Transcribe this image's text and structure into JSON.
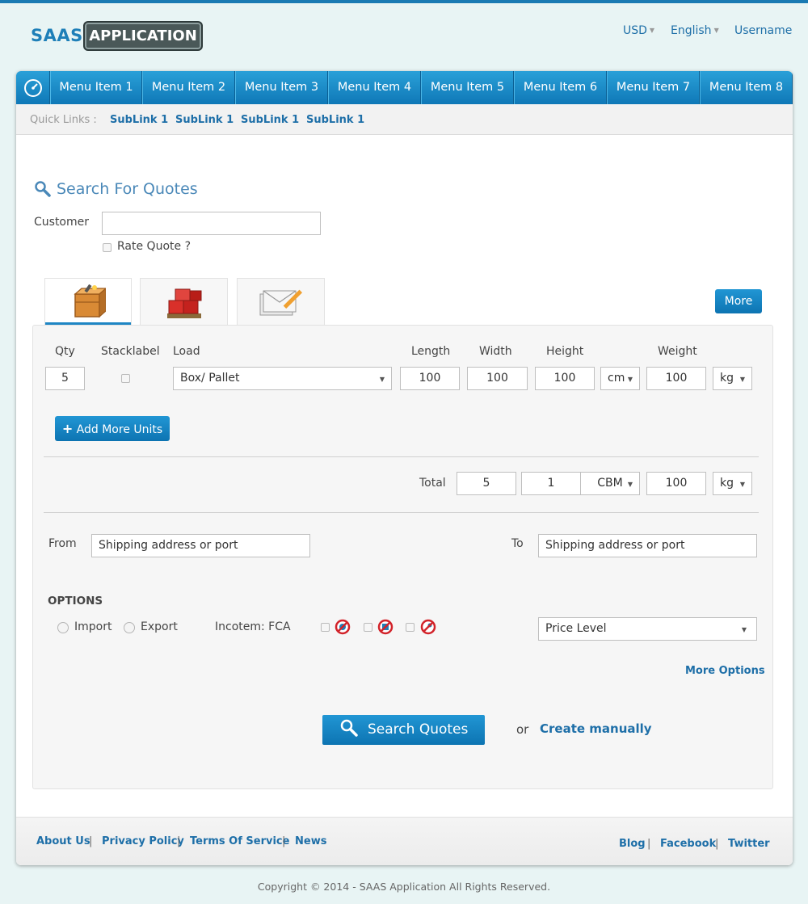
{
  "header": {
    "logo_saas": "SAAS",
    "logo_app": "APPLICATION",
    "currency": "USD",
    "language": "English",
    "username": "Username"
  },
  "nav": {
    "items": [
      "Menu Item 1",
      "Menu Item 2",
      "Menu Item 3",
      "Menu Item 4",
      "Menu Item 5",
      "Menu Item 6",
      "Menu Item 7",
      "Menu Item 8"
    ]
  },
  "subnav": {
    "label": "Quick Links :",
    "links": [
      "SubLink 1",
      "SubLink 1",
      "SubLink 1",
      "SubLink 1"
    ]
  },
  "search": {
    "title": "Search For Quotes",
    "customer_label": "Customer",
    "customer_value": "",
    "rate_quote_label": "Rate Quote ?"
  },
  "tabs": {
    "icons": [
      "crate-icon",
      "pallet-boxes-icon",
      "envelope-edit-icon"
    ],
    "more_label": "More"
  },
  "units": {
    "headers": {
      "qty": "Qty",
      "stack": "Stacklabel",
      "load": "Load",
      "length": "Length",
      "width": "Width",
      "height": "Height",
      "weight": "Weight"
    },
    "row": {
      "qty": "5",
      "load": "Box/ Pallet",
      "length": "100",
      "width": "100",
      "height": "100",
      "dim_unit": "cm",
      "weight": "100",
      "weight_unit": "kg"
    },
    "add_more_label": "Add More Units"
  },
  "totals": {
    "label": "Total",
    "qty": "5",
    "volume": "1",
    "volume_unit": "CBM",
    "weight": "100",
    "weight_unit": "kg"
  },
  "route": {
    "from_label": "From",
    "from_placeholder": "Shipping address or port",
    "to_label": "To",
    "to_placeholder": "Shipping address or port"
  },
  "options": {
    "title": "OPTIONS",
    "import_label": "Import",
    "export_label": "Export",
    "incoterm_label": "Incotem: FCA",
    "price_level": "Price Level",
    "more_options": "More Options"
  },
  "actions": {
    "search_label": "Search Quotes",
    "or": "or",
    "create_manually": "Create manually"
  },
  "footer": {
    "left_links": [
      "About Us",
      "Privacy Policy",
      "Terms Of Service",
      "News"
    ],
    "right_links": [
      "Blog",
      "Facebook",
      "Twitter"
    ],
    "separator": "|",
    "copyright": "Copyright © 2014 - SAAS Application All Rights Reserved."
  },
  "colors": {
    "brand_blue": "#1a7ab3",
    "link": "#1e6fa8",
    "page_bg": "#e8f4f4"
  }
}
